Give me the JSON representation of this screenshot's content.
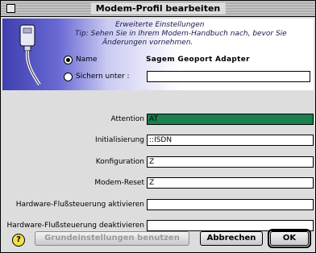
{
  "window": {
    "title": "Modem-Profil bearbeiten"
  },
  "header": {
    "hint_line1": "Erweiterte Einstellungen",
    "hint_line2": "Tip: Sehen Sie in Ihrem Modem-Handbuch nach, bevor Sie",
    "hint_line3": "Änderungen vornehmen.",
    "radio_name_label": "Name",
    "radio_sichern_label": "Sichern unter :",
    "profile_name": "Sagem Geoport Adapter",
    "sichern_value": ""
  },
  "fields": [
    {
      "label": "Attention",
      "value": "AT"
    },
    {
      "label": "Initialisierung",
      "value": "::ISDN"
    },
    {
      "label": "Konfiguration",
      "value": "Z"
    },
    {
      "label": "Modem-Reset",
      "value": "Z"
    },
    {
      "label": "Hardware-Flußsteuerung aktivieren",
      "value": ""
    },
    {
      "label": "Hardware-Flußsteuerung deaktivieren",
      "value": ""
    }
  ],
  "buttons": {
    "help": "?",
    "defaults": "Grundeinstellungen benutzen",
    "cancel": "Abbrechen",
    "ok": "OK"
  }
}
